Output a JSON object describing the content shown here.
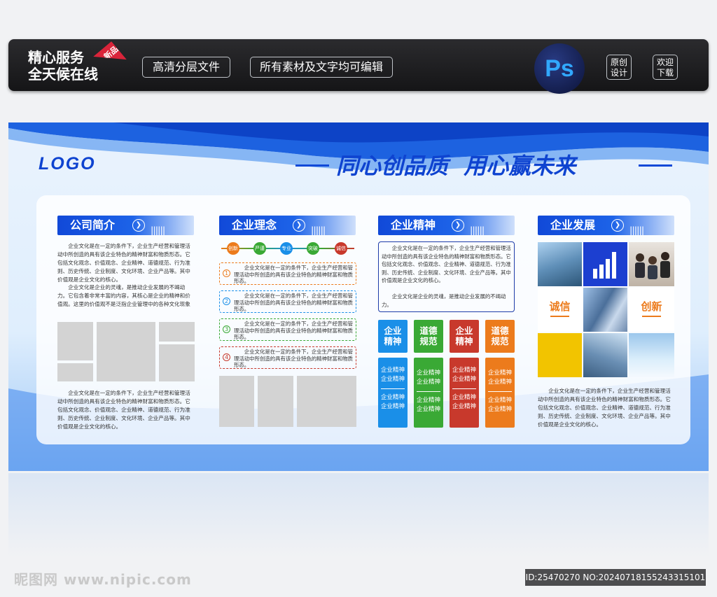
{
  "banner": {
    "slogan_line1": "精心服务",
    "slogan_line2": "全天候在线",
    "new_tag": "新品",
    "pill1": "高清分层文件",
    "pill2": "所有素材及文字均可编辑",
    "ps_logo": "Ps",
    "original_line1": "原创",
    "original_line2": "设计",
    "welcome_line1": "欢迎",
    "welcome_line2": "下载"
  },
  "board": {
    "logo": "LOGO",
    "headline": "同心创品质  用心赢未来",
    "sections": {
      "company": {
        "title": "公司简介",
        "para1": "企业文化是在一定的条件下，企业生产经营和管理活动中所创造的具有该企业特色的精神财富和物质形态。它包括文化观念、价值观念、企业精神、道德规范、行为准则、历史传统、企业制度、文化环境、企业产品等。其中价值观是企业文化的核心。",
        "para2": "企业文化是企业的灵魂，是推动企业发展的不竭动力。它包含着非常丰富的内容，其核心是企业的精神和价值观。这里的价值观不是泛指企业管理中的各种文化现象",
        "para3": "企业文化是在一定的条件下，企业生产经营和管理活动中所创造的具有该企业特色的精神财富和物质形态。它包括文化观念、价值观念、企业精神、道德规范、行为准则、历史传统、企业制度、文化环境、企业产品等。其中价值观是企业文化的核心。"
      },
      "philosophy": {
        "title": "企业理念",
        "keywords": [
          "创新",
          "严谨",
          "专业",
          "突破",
          "诚信"
        ],
        "items": [
          {
            "num": "1",
            "text": "企业文化是在一定的条件下，企业生产经营和管理活动中所创造的具有该企业特色的精神财富和物质形态。"
          },
          {
            "num": "2",
            "text": "企业文化是在一定的条件下，企业生产经营和管理活动中所创造的具有该企业特色的精神财富和物质形态。"
          },
          {
            "num": "3",
            "text": "企业文化是在一定的条件下，企业生产经营和管理活动中所创造的具有该企业特色的精神财富和物质形态。"
          },
          {
            "num": "4",
            "text": "企业文化是在一定的条件下，企业生产经营和管理活动中所创造的具有该企业特色的精神财富和物质形态。"
          }
        ]
      },
      "spirit": {
        "title": "企业精神",
        "box_para1": "企业文化是在一定的条件下，企业生产经营和管理活动中所创造的具有该企业特色的精神财富和物质形态。它包括文化观念、价值观念、企业精神、道德规范、行为准则、历史传统、企业制度、文化环境、企业产品等。其中价值观是企业文化的核心。",
        "box_para2": "企业文化是企业的灵魂，是推动企业发展的不竭动力。",
        "tiles": [
          {
            "l1": "企业",
            "l2": "精神",
            "color": "#1a8fe8"
          },
          {
            "l1": "道德",
            "l2": "规范",
            "color": "#3aa935"
          },
          {
            "l1": "企业",
            "l2": "精神",
            "color": "#c8392c"
          },
          {
            "l1": "道德",
            "l2": "规范",
            "color": "#ec7b1c"
          }
        ],
        "sub_l1": "企业精神",
        "sub_l2": "企业精神"
      },
      "development": {
        "title": "企业发展",
        "word1": "诚信",
        "word2": "创新",
        "para": "企业文化是在一定的条件下，企业生产经营和管理活动中所创造的具有该企业特色的精神财富和物质形态。它包括文化观念、价值观念、企业精神、道德规范、行为准则、历史传统、企业制度、文化环境、企业产品等。其中价值观是企业文化的核心。"
      }
    }
  },
  "footer": {
    "watermark": "昵图网 www.nipic.com",
    "id_text": "ID:25470270 NO:20240718155243315101"
  },
  "colors": {
    "accent_blue": "#1149d8",
    "tile_blue": "#1a8fe8",
    "tile_green": "#3aa935",
    "tile_red": "#c8392c",
    "tile_orange": "#ec7b1c",
    "yellow": "#f2c400"
  }
}
